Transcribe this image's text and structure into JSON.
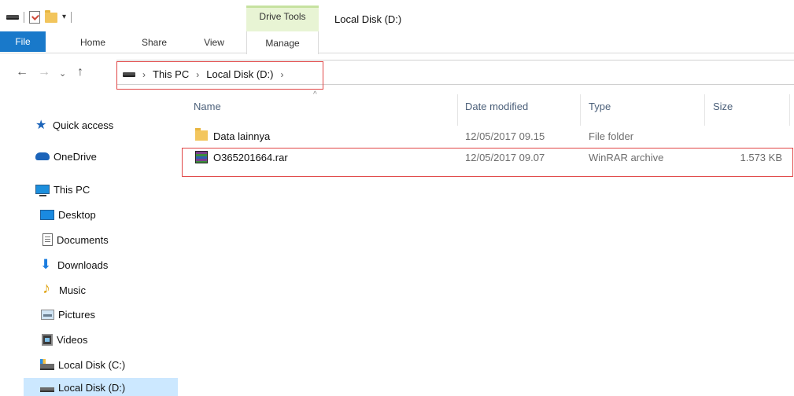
{
  "titlebar": {
    "context_tab_label": "Drive Tools",
    "window_title": "Local Disk (D:)"
  },
  "ribbon": {
    "tabs": [
      {
        "label": "File"
      },
      {
        "label": "Home"
      },
      {
        "label": "Share"
      },
      {
        "label": "View"
      },
      {
        "label": "Manage"
      }
    ]
  },
  "address_bar": {
    "segments": [
      "This PC",
      "Local Disk (D:)"
    ]
  },
  "nav_pane": {
    "items": [
      {
        "label": "Quick access",
        "icon": "star-icon"
      },
      {
        "label": "OneDrive",
        "icon": "cloud-icon"
      },
      {
        "label": "This PC",
        "icon": "computer-icon"
      },
      {
        "label": "Desktop",
        "icon": "desktop-icon"
      },
      {
        "label": "Documents",
        "icon": "document-icon"
      },
      {
        "label": "Downloads",
        "icon": "download-arrow-icon"
      },
      {
        "label": "Music",
        "icon": "music-note-icon"
      },
      {
        "label": "Pictures",
        "icon": "pictures-icon"
      },
      {
        "label": "Videos",
        "icon": "film-icon"
      },
      {
        "label": "Local Disk (C:)",
        "icon": "windows-drive-icon"
      },
      {
        "label": "Local Disk (D:)",
        "icon": "drive-icon"
      }
    ]
  },
  "file_list": {
    "columns": [
      "Name",
      "Date modified",
      "Type",
      "Size"
    ],
    "rows": [
      {
        "name": "Data lainnya",
        "date": "12/05/2017 09.15",
        "type": "File folder",
        "size": "",
        "icon": "folder-icon"
      },
      {
        "name": "O365201664.rar",
        "date": "12/05/2017 09.07",
        "type": "WinRAR archive",
        "size": "1.573 KB",
        "icon": "winrar-icon"
      }
    ]
  },
  "colors": {
    "file_tab_bg": "#1979ca",
    "context_tab_bg": "#e8f4d4",
    "highlight_box": "#e04545",
    "selection_bg": "#cce8ff",
    "column_header_text": "#4c607a"
  }
}
